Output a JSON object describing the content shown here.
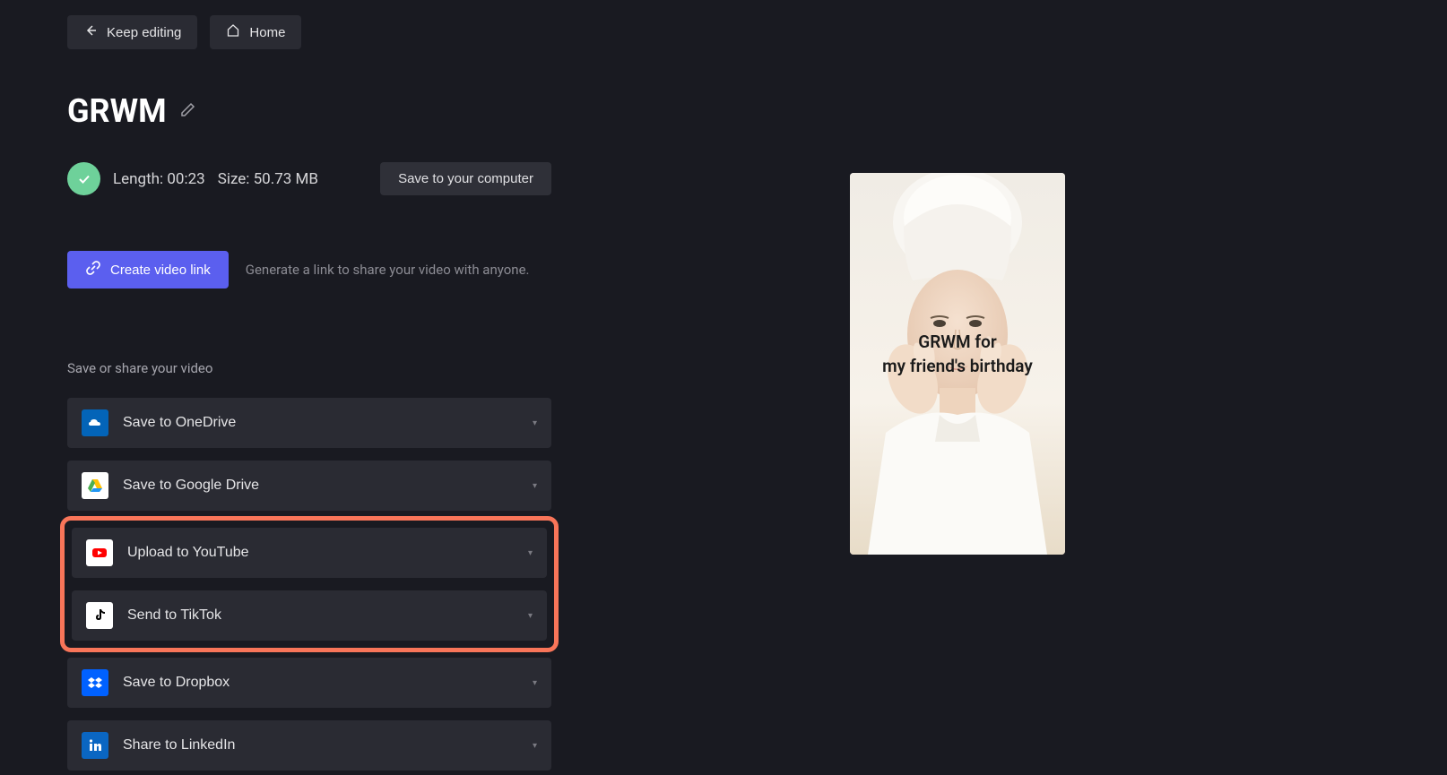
{
  "top": {
    "keep_editing": "Keep editing",
    "home": "Home"
  },
  "title": "GRWM",
  "meta": {
    "length_label": "Length:",
    "length_value": "00:23",
    "size_label": "Size:",
    "size_value": "50.73 MB",
    "save_computer": "Save to your computer"
  },
  "link": {
    "create": "Create video link",
    "hint": "Generate a link to share your video with anyone."
  },
  "share": {
    "section_label": "Save or share your video",
    "items": [
      {
        "label": "Save to OneDrive",
        "icon": "onedrive"
      },
      {
        "label": "Save to Google Drive",
        "icon": "gdrive"
      },
      {
        "label": "Upload to YouTube",
        "icon": "youtube"
      },
      {
        "label": "Send to TikTok",
        "icon": "tiktok"
      },
      {
        "label": "Save to Dropbox",
        "icon": "dropbox"
      },
      {
        "label": "Share to LinkedIn",
        "icon": "linkedin"
      }
    ]
  },
  "preview": {
    "line1": "GRWM for",
    "line2": "my friend's birthday"
  }
}
